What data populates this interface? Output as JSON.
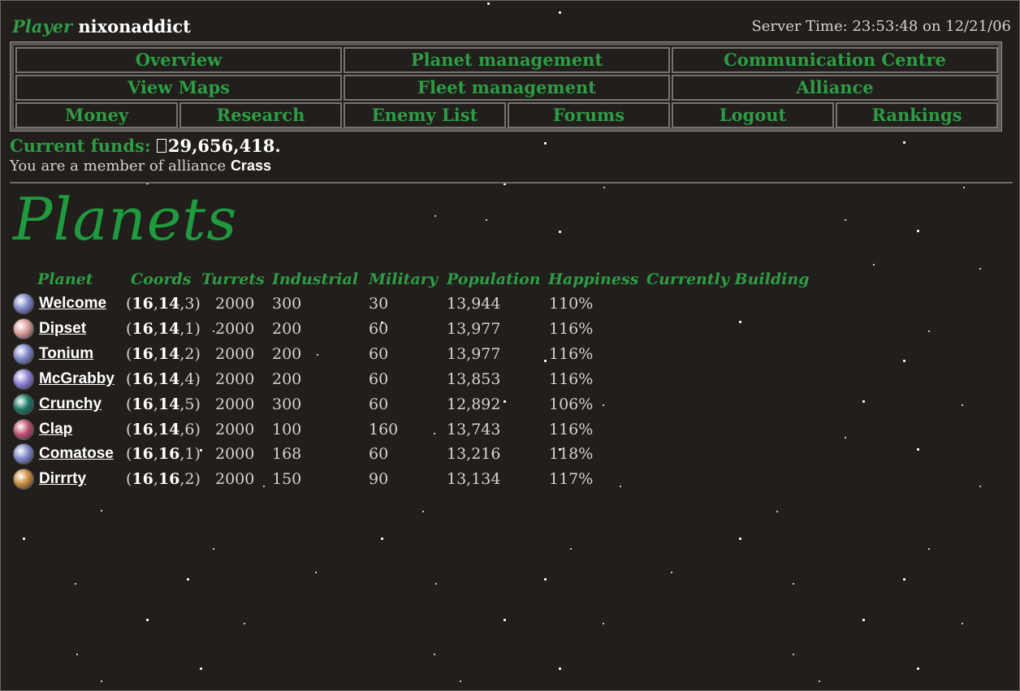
{
  "header": {
    "player_label": "Player",
    "player_name": "nixonaddict",
    "server_time": "Server Time: 23:53:48 on 12/21/06"
  },
  "nav": {
    "overview": "Overview",
    "planet_management": "Planet management",
    "communication_centre": "Communication Centre",
    "view_maps": "View Maps",
    "fleet_management": "Fleet management",
    "alliance": "Alliance",
    "money": "Money",
    "research": "Research",
    "enemy_list": "Enemy List",
    "forums": "Forums",
    "logout": "Logout",
    "rankings": "Rankings"
  },
  "funds": {
    "label": "Current funds:",
    "amount": "29,656,418."
  },
  "alliance": {
    "prefix": "You are a member of alliance",
    "name": "Crass"
  },
  "page_title": "Planets",
  "table": {
    "headers": {
      "planet": "Planet",
      "coords": "Coords",
      "turrets": "Turrets",
      "industrial": "Industrial",
      "military": "Military",
      "population": "Population",
      "happiness": "Happiness",
      "building": "Currently Building"
    },
    "rows": [
      {
        "name": "Welcome",
        "c1": "16",
        "c2": "14",
        "c3": "3",
        "turrets": "2000",
        "industrial": "300",
        "military": "30",
        "population": "13,944",
        "happiness": "110%",
        "icon": "blue-white-planet",
        "color": "#7d86c8"
      },
      {
        "name": "Dipset",
        "c1": "16",
        "c2": "14",
        "c3": "1",
        "turrets": "2000",
        "industrial": "200",
        "military": "60",
        "population": "13,977",
        "happiness": "116%",
        "icon": "pink-planet",
        "color": "#d99a93"
      },
      {
        "name": "Tonium",
        "c1": "16",
        "c2": "14",
        "c3": "2",
        "turrets": "2000",
        "industrial": "200",
        "military": "60",
        "population": "13,977",
        "happiness": "116%",
        "icon": "blue-white-planet",
        "color": "#7d86c8"
      },
      {
        "name": "McGrabby",
        "c1": "16",
        "c2": "14",
        "c3": "4",
        "turrets": "2000",
        "industrial": "200",
        "military": "60",
        "population": "13,853",
        "happiness": "116%",
        "icon": "violet-planet",
        "color": "#8a7fd0"
      },
      {
        "name": "Crunchy",
        "c1": "16",
        "c2": "14",
        "c3": "5",
        "turrets": "2000",
        "industrial": "300",
        "military": "60",
        "population": "12,892",
        "happiness": "106%",
        "icon": "green-planet",
        "color": "#1c7a62"
      },
      {
        "name": "Clap",
        "c1": "16",
        "c2": "14",
        "c3": "6",
        "turrets": "2000",
        "industrial": "100",
        "military": "160",
        "population": "13,743",
        "happiness": "116%",
        "icon": "red-blue-planet",
        "color": "#c05070"
      },
      {
        "name": "Comatose",
        "c1": "16",
        "c2": "16",
        "c3": "1",
        "turrets": "2000",
        "industrial": "168",
        "military": "60",
        "population": "13,216",
        "happiness": "118%",
        "icon": "blue-white-planet",
        "color": "#7d86c8"
      },
      {
        "name": "Dirrrty",
        "c1": "16",
        "c2": "16",
        "c3": "2",
        "turrets": "2000",
        "industrial": "150",
        "military": "90",
        "population": "13,134",
        "happiness": "117%",
        "icon": "orange-planet",
        "color": "#c88a3a"
      }
    ]
  }
}
